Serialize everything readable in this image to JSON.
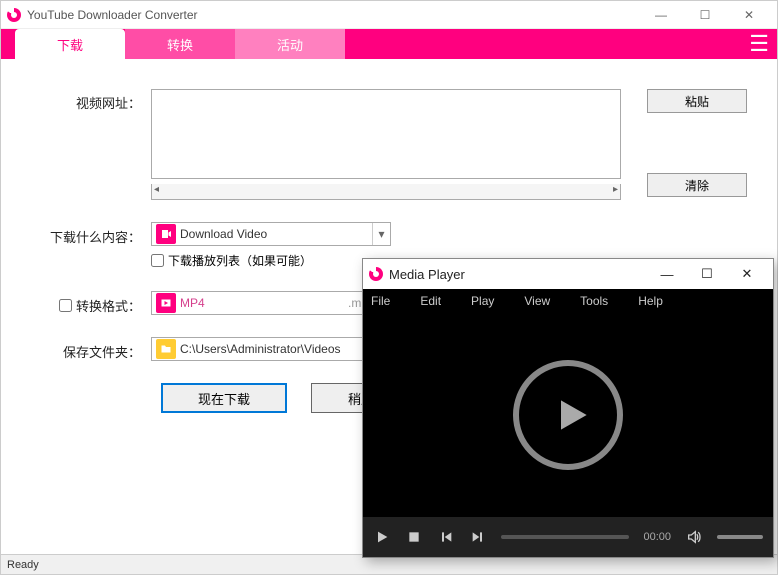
{
  "window": {
    "title": "YouTube Downloader Converter",
    "status": "Ready"
  },
  "tabs": {
    "download": "下载",
    "convert": "转换",
    "activity": "活动"
  },
  "labels": {
    "video_url": "视频网址：",
    "download_what": "下载什么内容：",
    "convert_format": "转换格式：",
    "save_folder": "保存文件夹：",
    "download_playlist": "下载播放列表（如果可能）"
  },
  "buttons": {
    "paste": "粘贴",
    "clear": "清除",
    "download_now": "现在下载",
    "download_later": "稍后下载"
  },
  "values": {
    "download_mode": "Download Video",
    "format": "MP4",
    "format_ext": ".mp",
    "save_path": "C:\\Users\\Administrator\\Videos"
  },
  "media_player": {
    "title": "Media Player",
    "menu": {
      "file": "File",
      "edit": "Edit",
      "play": "Play",
      "view": "View",
      "tools": "Tools",
      "help": "Help"
    },
    "time": "00:00"
  }
}
